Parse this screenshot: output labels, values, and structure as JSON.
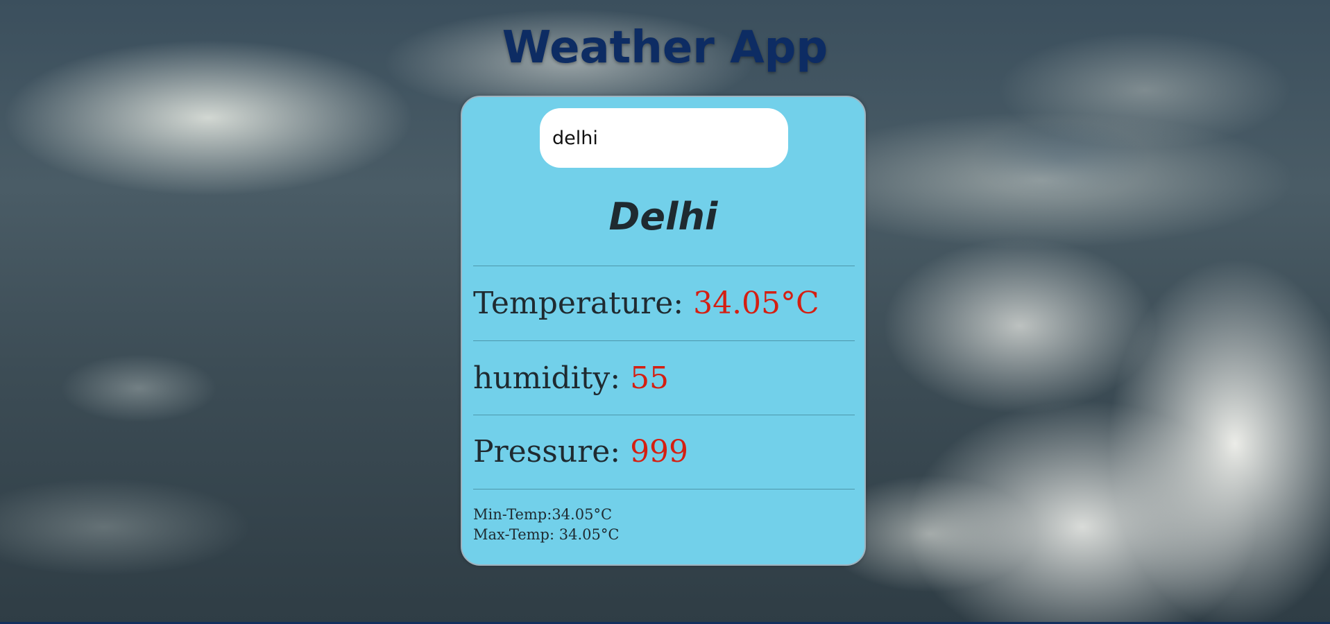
{
  "app": {
    "title": "Weather App"
  },
  "search": {
    "value": "delhi"
  },
  "weather": {
    "city": "Delhi",
    "temperature_label": "Temperature: ",
    "temperature_value": "34.05°C",
    "humidity_label": "humidity: ",
    "humidity_value": "55",
    "pressure_label": "Pressure: ",
    "pressure_value": "999",
    "min_temp_text": "Min-Temp:34.05°C",
    "max_temp_text": "Max-Temp: 34.05°C"
  },
  "colors": {
    "title": "#0d2c63",
    "card_background": "#72d0ea",
    "value_accent": "#d41f12",
    "text": "#1f2a30"
  }
}
